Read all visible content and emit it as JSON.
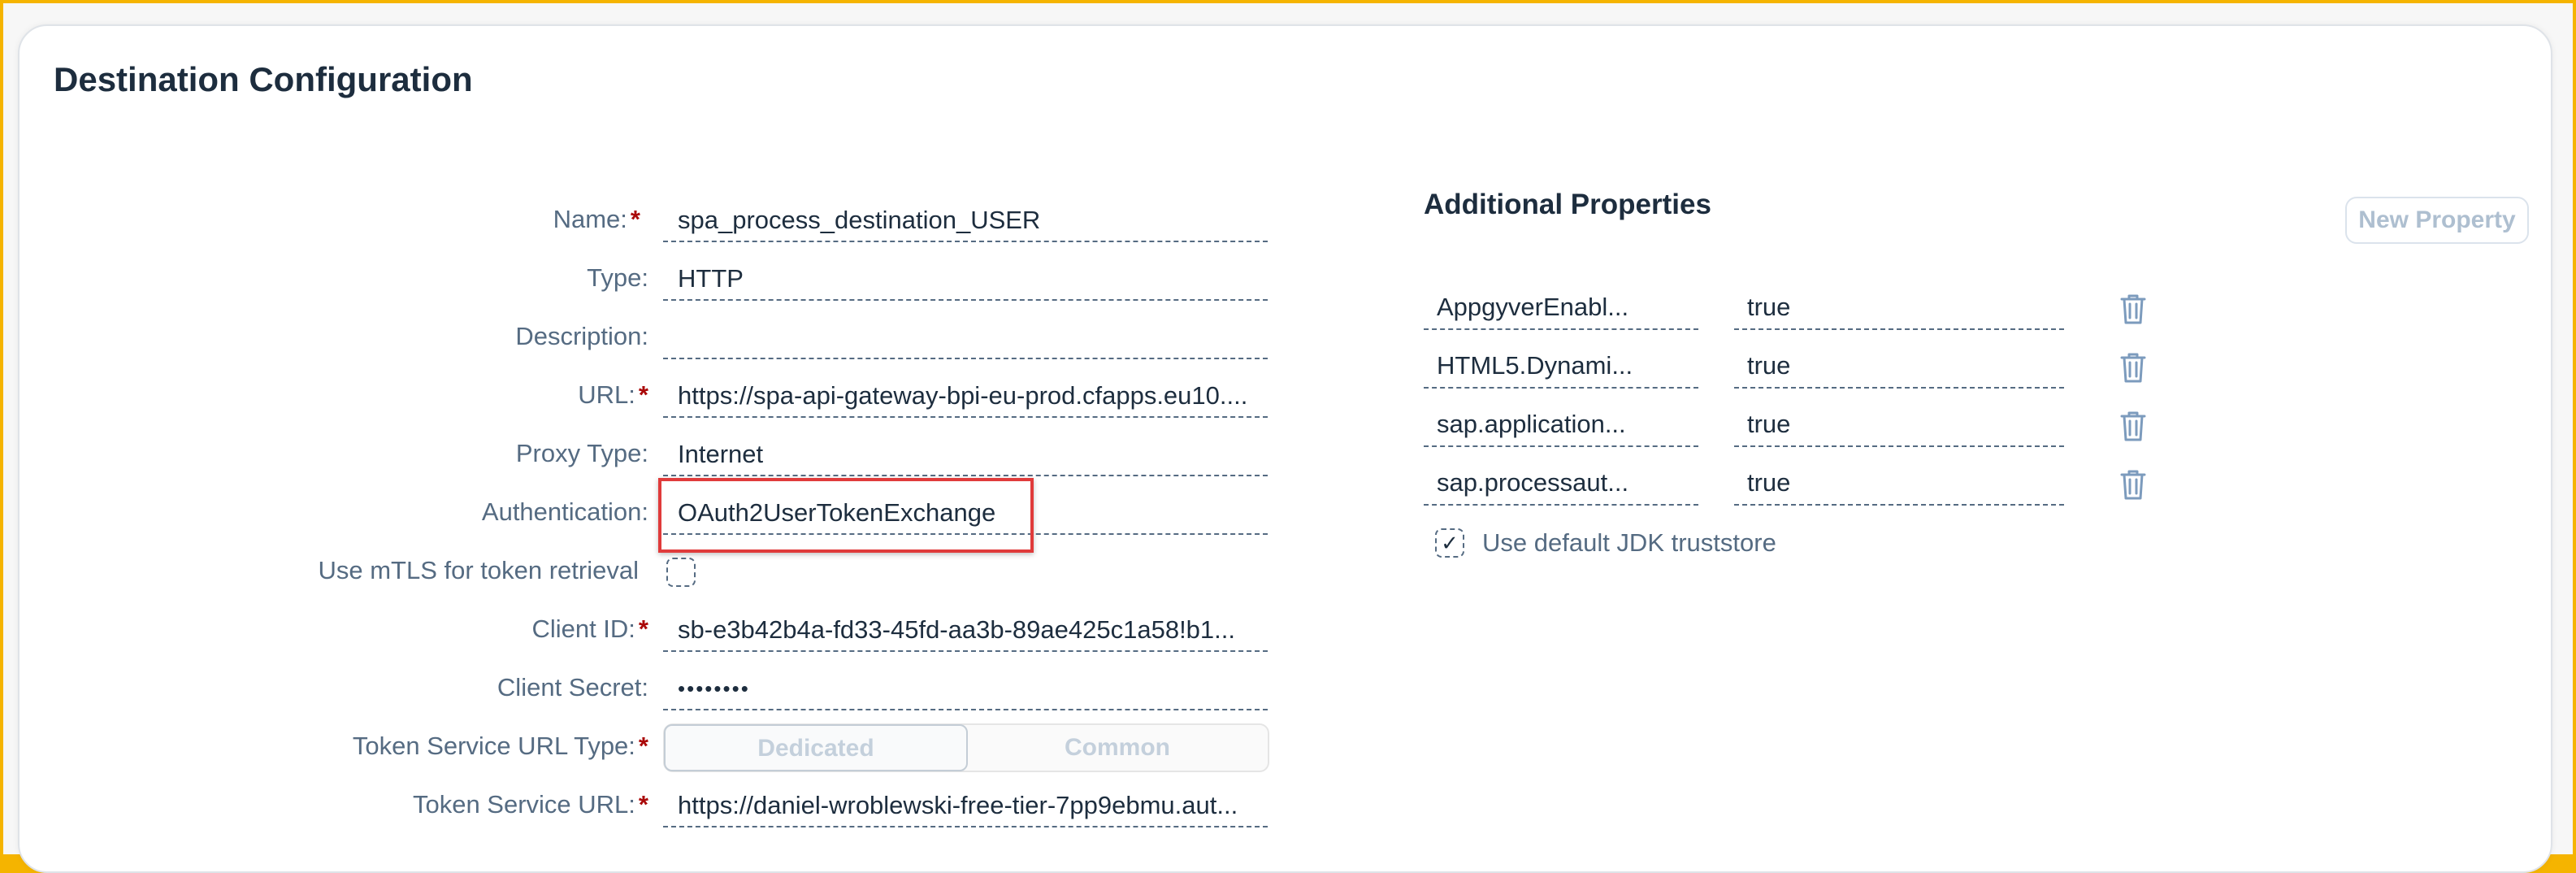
{
  "page_title": "Destination Configuration",
  "required_marker": "*",
  "form": [
    {
      "label": "Name:",
      "required": true,
      "value": "spa_process_destination_USER"
    },
    {
      "label": "Type:",
      "required": false,
      "value": "HTTP"
    },
    {
      "label": "Description:",
      "required": false,
      "value": ""
    },
    {
      "label": "URL:",
      "required": true,
      "value": "https://spa-api-gateway-bpi-eu-prod.cfapps.eu10...."
    },
    {
      "label": "Proxy Type:",
      "required": false,
      "value": "Internet"
    },
    {
      "label": "Authentication:",
      "required": false,
      "value": "OAuth2UserTokenExchange"
    },
    {
      "label": "Use mTLS for token retrieval",
      "required": false,
      "value": ""
    },
    {
      "label": "Client ID:",
      "required": true,
      "value": "sb-e3b42b4a-fd33-45fd-aa3b-89ae425c1a58!b1..."
    },
    {
      "label": "Client Secret:",
      "required": false,
      "value": "••••••••"
    },
    {
      "label": "Token Service URL Type:",
      "required": true,
      "options": [
        "Dedicated",
        "Common"
      ],
      "selected": "Dedicated"
    },
    {
      "label": "Token Service URL:",
      "required": true,
      "value": "https://daniel-wroblewski-free-tier-7pp9ebmu.aut..."
    }
  ],
  "mtls_checked": false,
  "additional_properties": {
    "title": "Additional Properties",
    "new_button": "New Property",
    "items": [
      {
        "key": "AppgyverEnabl...",
        "value": "true"
      },
      {
        "key": "HTML5.Dynami...",
        "value": "true"
      },
      {
        "key": "sap.application...",
        "value": "true"
      },
      {
        "key": "sap.processaut...",
        "value": "true"
      }
    ],
    "use_default_jdk_label": "Use default JDK truststore",
    "use_default_jdk_checked": true,
    "delete_icon": "trash-icon",
    "check_icon": "✓"
  },
  "colors": {
    "border_accent": "#f5b400",
    "required": "#aa0808",
    "highlight": "#e03b3b",
    "label": "#556b82"
  }
}
